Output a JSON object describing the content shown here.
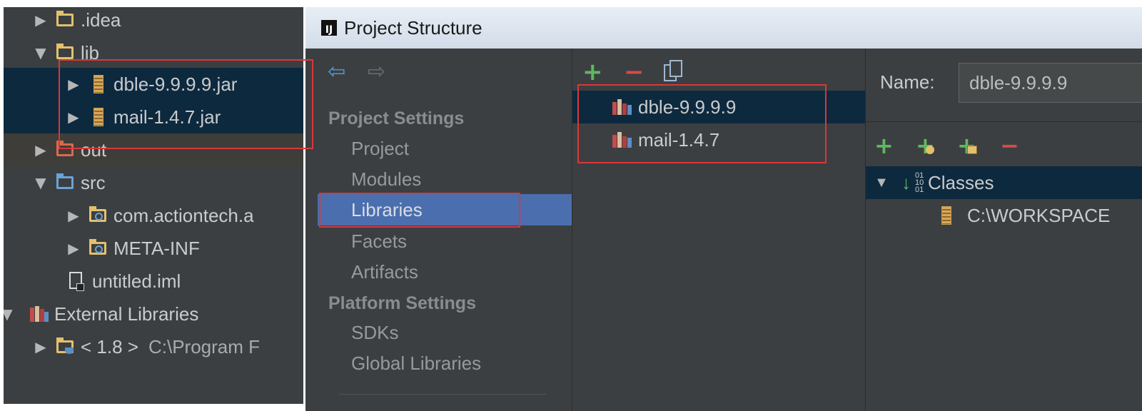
{
  "tree": {
    "items": [
      {
        "label": ".idea"
      },
      {
        "label": "lib"
      },
      {
        "label": "dble-9.9.9.9.jar"
      },
      {
        "label": "mail-1.4.7.jar"
      },
      {
        "label": "out"
      },
      {
        "label": "src"
      },
      {
        "label": "com.actiontech.a"
      },
      {
        "label": "META-INF"
      },
      {
        "label": "untitled.iml"
      },
      {
        "label": "External Libraries"
      },
      {
        "label": "< 1.8 >",
        "detail": "C:\\Program F"
      }
    ]
  },
  "dialog": {
    "title": "Project Structure",
    "sections": {
      "project_settings": "Project Settings",
      "platform_settings": "Platform Settings"
    },
    "nav": {
      "project": "Project",
      "modules": "Modules",
      "libraries": "Libraries",
      "facets": "Facets",
      "artifacts": "Artifacts",
      "sdks": "SDKs",
      "global_libraries": "Global Libraries"
    },
    "libraries": [
      {
        "name": "dble-9.9.9.9"
      },
      {
        "name": "mail-1.4.7"
      }
    ],
    "detail": {
      "name_label": "Name:",
      "name_value": "dble-9.9.9.9",
      "classes_label": "Classes",
      "class_path": "C:\\WORKSPACE"
    }
  },
  "colors": {
    "tree_bg": "#3c3f41",
    "selection": "#0d293e",
    "nav_selected": "#4b6eaf",
    "highlight_box": "#d8383a",
    "add": "#5fb85f",
    "remove": "#d94a4a"
  }
}
